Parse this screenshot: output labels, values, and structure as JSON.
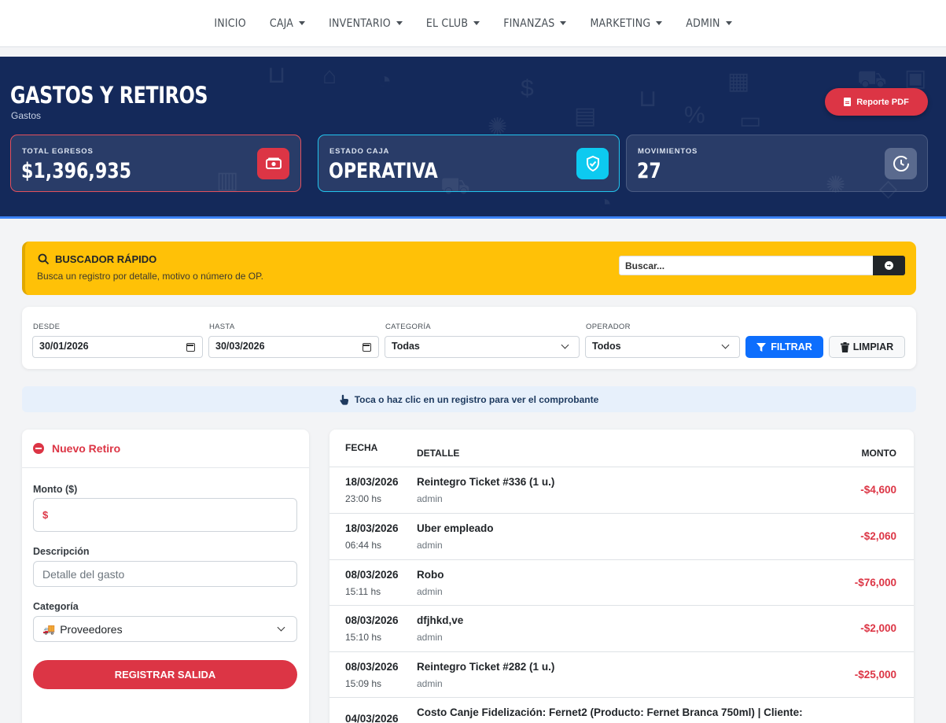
{
  "nav": {
    "items": [
      {
        "label": "INICIO",
        "dropdown": false
      },
      {
        "label": "CAJA",
        "dropdown": true
      },
      {
        "label": "INVENTARIO",
        "dropdown": true
      },
      {
        "label": "EL CLUB",
        "dropdown": true
      },
      {
        "label": "FINANZAS",
        "dropdown": true
      },
      {
        "label": "MARKETING",
        "dropdown": true
      },
      {
        "label": "ADMIN",
        "dropdown": true
      }
    ]
  },
  "header": {
    "title": "GASTOS Y RETIROS",
    "subtitle": "Gastos",
    "report_button": "Reporte PDF"
  },
  "stats": [
    {
      "label": "TOTAL EGRESOS",
      "value": "$1,396,935",
      "icon": "money-bill-icon",
      "accent": "#dc3545"
    },
    {
      "label": "ESTADO CAJA",
      "value": "OPERATIVA",
      "icon": "shield-check-icon",
      "accent": "#0dcaf0"
    },
    {
      "label": "MOVIMIENTOS",
      "value": "27",
      "icon": "clock-icon",
      "accent": "#5a6a8e"
    }
  ],
  "search": {
    "title": "BUSCADOR RÁPIDO",
    "description": "Busca un registro por detalle, motivo o número de OP.",
    "placeholder": "Buscar..."
  },
  "filters": {
    "desde_label": "DESDE",
    "desde_value": "30/01/2026",
    "hasta_label": "HASTA",
    "hasta_value": "30/03/2026",
    "categoria_label": "CATEGORÍA",
    "categoria_value": "Todas",
    "operador_label": "OPERADOR",
    "operador_value": "Todos",
    "filtrar_label": "FILTRAR",
    "limpiar_label": "LIMPIAR"
  },
  "hint": "Toca o haz clic en un registro para ver el comprobante",
  "new_withdrawal": {
    "title": "Nuevo Retiro",
    "monto_label": "Monto ($)",
    "monto_prefix": "$",
    "descripcion_label": "Descripción",
    "descripcion_placeholder": "Detalle del gasto",
    "categoria_label": "Categoría",
    "categoria_value": "Proveedores",
    "categoria_emoji": "🚚",
    "submit_label": "REGISTRAR SALIDA"
  },
  "table": {
    "headers": {
      "fecha": "FECHA",
      "detalle": "DETALLE",
      "monto": "MONTO"
    },
    "rows": [
      {
        "date": "18/03/2026",
        "time": "23:00 hs",
        "detail": "Reintegro Ticket #336 (1 u.)",
        "user": "admin",
        "amount": "-$4,600"
      },
      {
        "date": "18/03/2026",
        "time": "06:44 hs",
        "detail": "Uber empleado",
        "user": "admin",
        "amount": "-$2,060"
      },
      {
        "date": "08/03/2026",
        "time": "15:11 hs",
        "detail": "Robo",
        "user": "admin",
        "amount": "-$76,000"
      },
      {
        "date": "08/03/2026",
        "time": "15:10 hs",
        "detail": "dfjhkd,ve",
        "user": "admin",
        "amount": "-$2,000"
      },
      {
        "date": "08/03/2026",
        "time": "15:09 hs",
        "detail": "Reintegro Ticket #282 (1 u.)",
        "user": "admin",
        "amount": "-$25,000"
      },
      {
        "date": "04/03/2026",
        "time": "",
        "detail": "Costo Canje Fidelización: Fernet2 (Producto: Fernet Branca 750ml) | Cliente:",
        "user": "",
        "amount": ""
      }
    ]
  }
}
